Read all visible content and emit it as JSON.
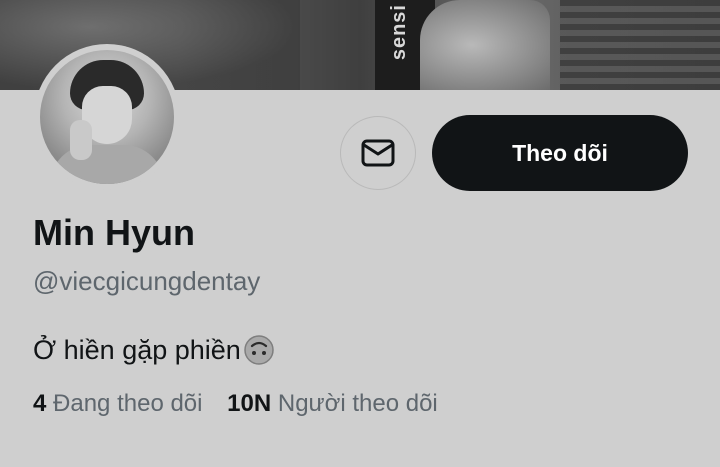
{
  "profile": {
    "name": "Min Hyun",
    "handle": "@viecgicungdentay",
    "bio": "Ở hiền gặp phiền",
    "bio_emoji": "upside-down-face-emoji",
    "banner_text": "sensi"
  },
  "actions": {
    "message_icon": "envelope-icon",
    "follow_label": "Theo dõi"
  },
  "stats": {
    "following_count": "4",
    "following_label": "Đang theo dõi",
    "followers_count": "10N",
    "followers_label": "Người theo dõi"
  },
  "colors": {
    "background": "#cfcfcf",
    "follow_button": "#111416",
    "secondary_text": "#5e666d"
  }
}
